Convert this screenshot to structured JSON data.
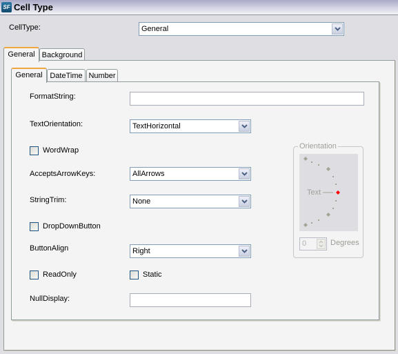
{
  "window": {
    "title": "Cell Type",
    "logo_text": "SF"
  },
  "celltype": {
    "label": "CellType:",
    "value": "General"
  },
  "outer_tabs": [
    {
      "label": "General",
      "active": true
    },
    {
      "label": "Background",
      "active": false
    }
  ],
  "inner_tabs": [
    {
      "label": "General",
      "active": true
    },
    {
      "label": "DateTime",
      "active": false
    },
    {
      "label": "Number",
      "active": false
    }
  ],
  "form": {
    "format_string": {
      "label": "FormatString:",
      "value": ""
    },
    "text_orientation": {
      "label": "TextOrientation:",
      "value": "TextHorizontal"
    },
    "word_wrap": {
      "label": "WordWrap",
      "checked": false
    },
    "accepts_arrow_keys": {
      "label": "AcceptsArrowKeys:",
      "value": "AllArrows"
    },
    "string_trim": {
      "label": "StringTrim:",
      "value": "None"
    },
    "drop_down_button": {
      "label": "DropDownButton",
      "checked": false
    },
    "button_align": {
      "label": "ButtonAlign",
      "value": "Right"
    },
    "read_only": {
      "label": "ReadOnly",
      "checked": false
    },
    "static": {
      "label": "Static",
      "checked": false
    },
    "null_display": {
      "label": "NullDisplay:",
      "value": ""
    }
  },
  "orientation": {
    "title": "Orientation",
    "preview_text": "Text",
    "degrees_value": "0",
    "degrees_label": "Degrees",
    "selected_color": "#ff0000",
    "enabled": false
  }
}
